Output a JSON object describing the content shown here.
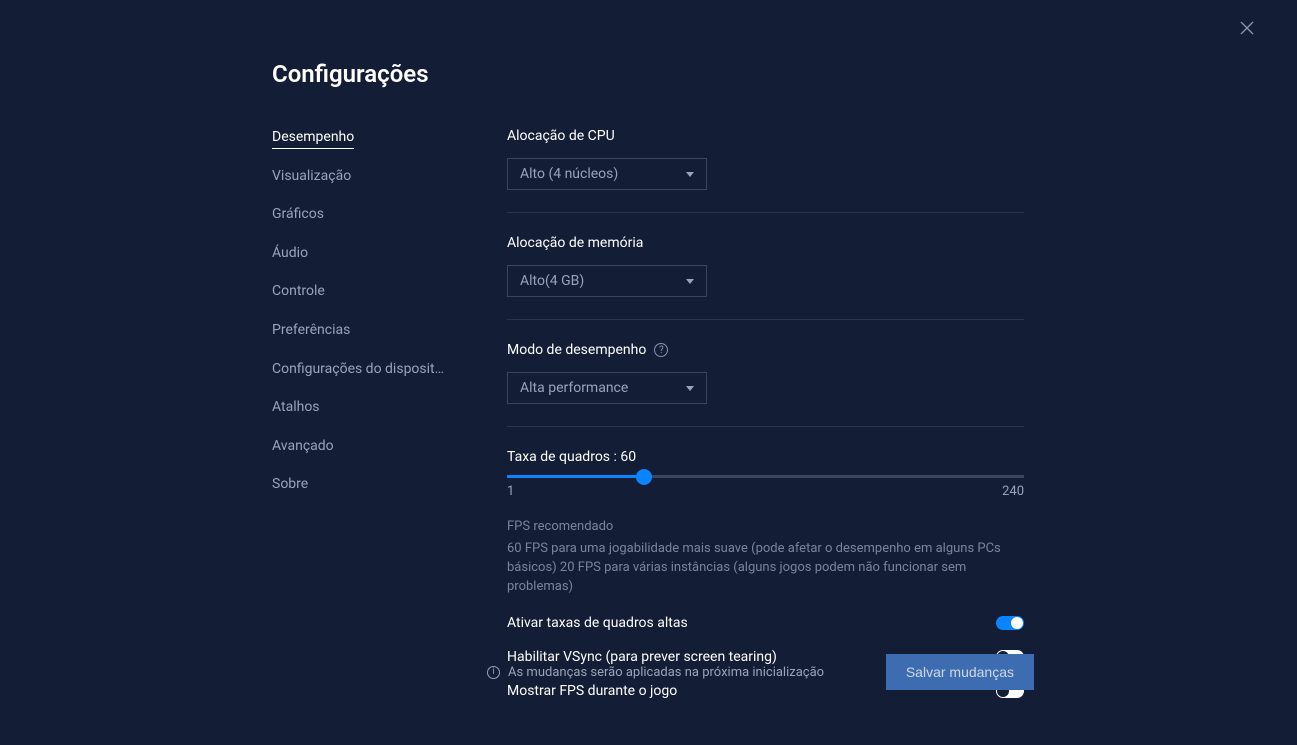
{
  "title": "Configurações",
  "sidebar": {
    "items": [
      "Desempenho",
      "Visualização",
      "Gráficos",
      "Áudio",
      "Controle",
      "Preferências",
      "Configurações do dispositi…",
      "Atalhos",
      "Avançado",
      "Sobre"
    ],
    "activeIndex": 0
  },
  "cpu": {
    "label": "Alocação de CPU",
    "value": "Alto (4 núcleos)"
  },
  "memory": {
    "label": "Alocação de memória",
    "value": "Alto(4 GB)"
  },
  "perfMode": {
    "label": "Modo de desempenho",
    "value": "Alta performance"
  },
  "fps": {
    "label": "Taxa de quadros : 60",
    "min": "1",
    "max": "240",
    "value": 60,
    "percent": 26.5,
    "hintTitle": "FPS recomendado",
    "hintText": "60 FPS para uma jogabilidade mais suave (pode afetar o desempenho em alguns PCs básicos) 20 FPS para várias instâncias (alguns jogos podem não funcionar sem problemas)"
  },
  "toggles": {
    "highFps": {
      "label": "Ativar taxas de quadros altas",
      "on": true
    },
    "vsync": {
      "label": "Habilitar VSync (para prever screen tearing)",
      "on": false
    },
    "showFps": {
      "label": "Mostrar FPS durante o jogo",
      "on": false
    }
  },
  "footer": {
    "message": "As mudanças serão aplicadas na próxima inicialização",
    "saveLabel": "Salvar mudanças"
  }
}
